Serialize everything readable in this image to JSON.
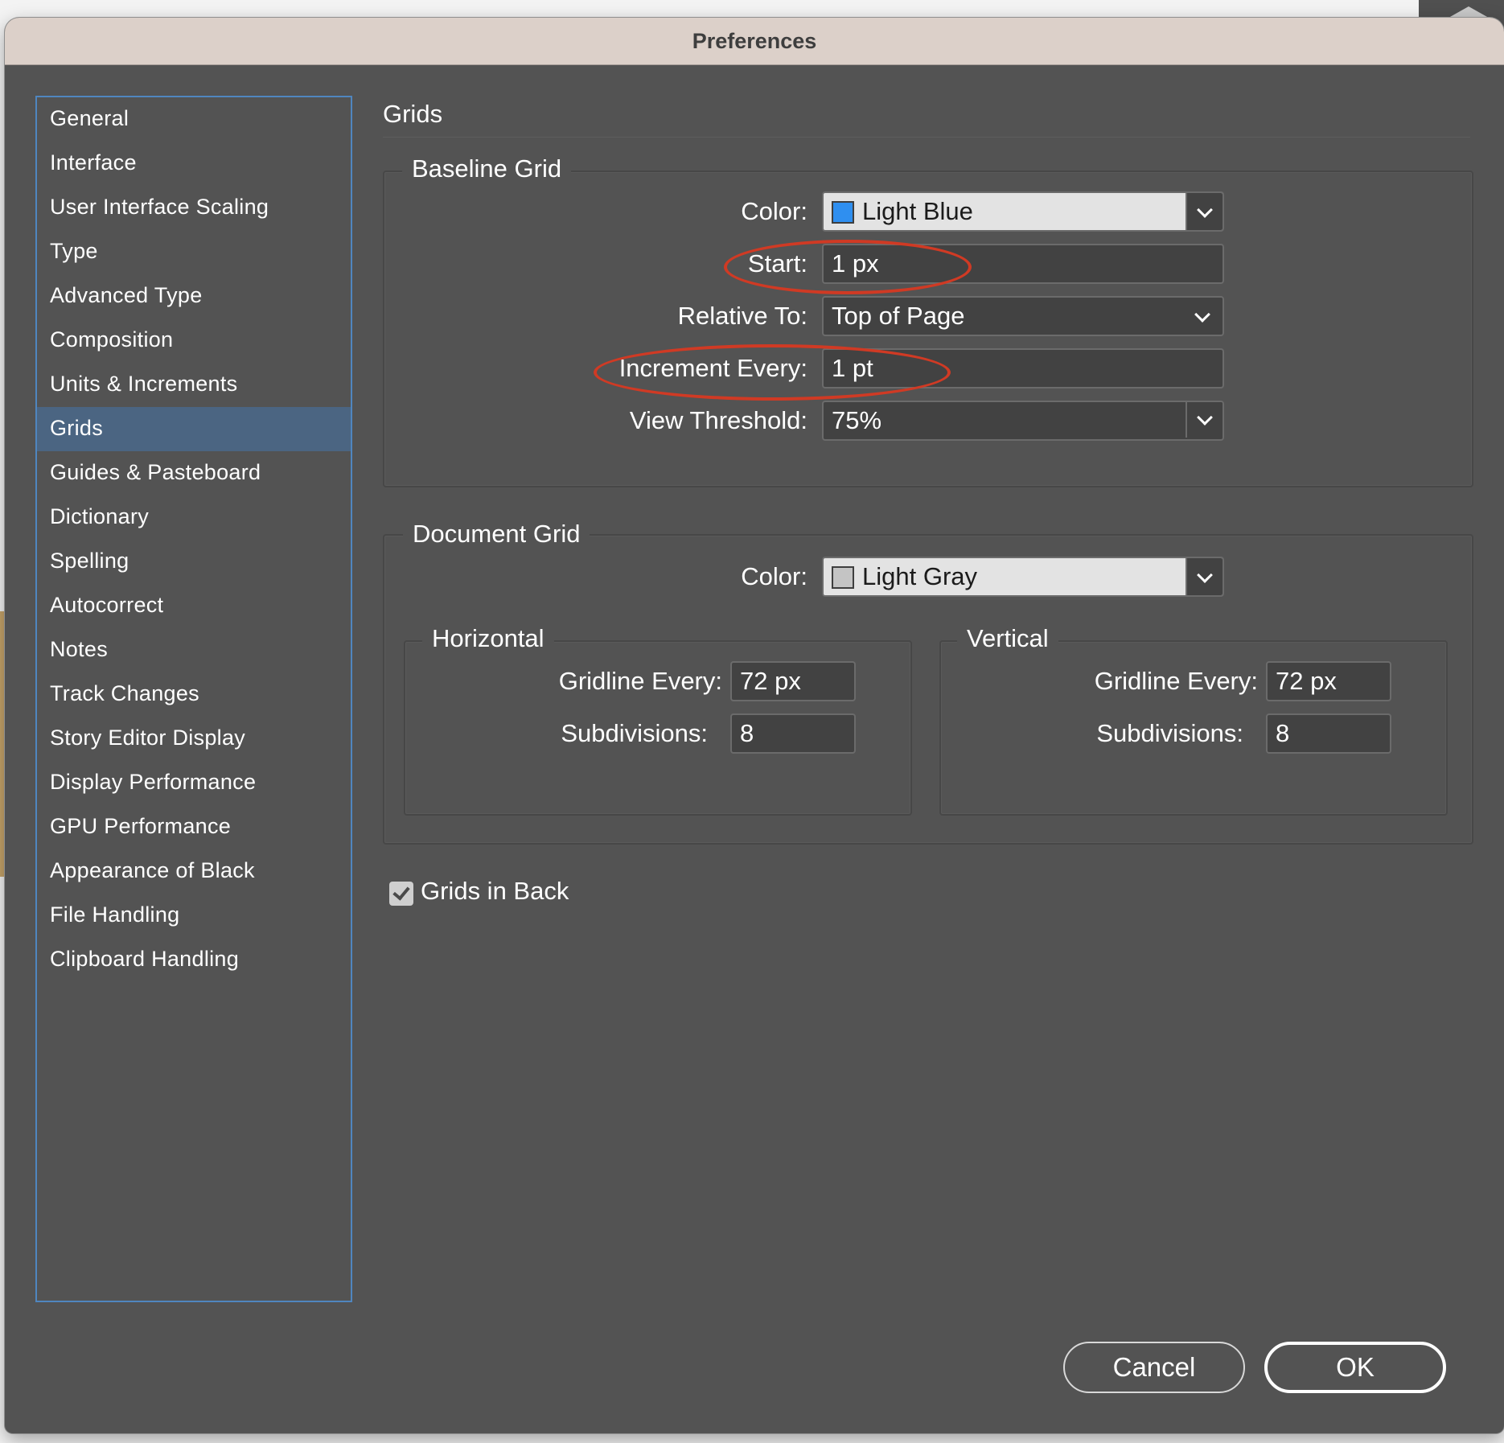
{
  "window": {
    "title": "Preferences"
  },
  "sidebar": {
    "items": [
      {
        "label": "General"
      },
      {
        "label": "Interface"
      },
      {
        "label": "User Interface Scaling"
      },
      {
        "label": "Type"
      },
      {
        "label": "Advanced Type"
      },
      {
        "label": "Composition"
      },
      {
        "label": "Units & Increments"
      },
      {
        "label": "Grids",
        "selected": true
      },
      {
        "label": "Guides & Pasteboard"
      },
      {
        "label": "Dictionary"
      },
      {
        "label": "Spelling"
      },
      {
        "label": "Autocorrect"
      },
      {
        "label": "Notes"
      },
      {
        "label": "Track Changes"
      },
      {
        "label": "Story Editor Display"
      },
      {
        "label": "Display Performance"
      },
      {
        "label": "GPU Performance"
      },
      {
        "label": "Appearance of Black"
      },
      {
        "label": "File Handling"
      },
      {
        "label": "Clipboard Handling"
      }
    ]
  },
  "panel": {
    "title": "Grids",
    "baseline_grid": {
      "legend": "Baseline Grid",
      "color_label": "Color:",
      "color_value": "Light Blue",
      "color_swatch": "#2f8ff0",
      "start_label": "Start:",
      "start_value": "1 px",
      "relative_label": "Relative To:",
      "relative_value": "Top of Page",
      "increment_label": "Increment Every:",
      "increment_value": "1 pt",
      "threshold_label": "View Threshold:",
      "threshold_value": "75%"
    },
    "document_grid": {
      "legend": "Document Grid",
      "color_label": "Color:",
      "color_value": "Light Gray",
      "color_swatch": "#c4c4c4",
      "horizontal": {
        "legend": "Horizontal",
        "gridline_label": "Gridline Every:",
        "gridline_value": "72 px",
        "subdivisions_label": "Subdivisions:",
        "subdivisions_value": "8"
      },
      "vertical": {
        "legend": "Vertical",
        "gridline_label": "Gridline Every:",
        "gridline_value": "72 px",
        "subdivisions_label": "Subdivisions:",
        "subdivisions_value": "8"
      }
    },
    "grids_in_back": {
      "label": "Grids in Back",
      "checked": true
    }
  },
  "buttons": {
    "cancel": "Cancel",
    "ok": "OK"
  },
  "annotation_color": "#d03a24"
}
